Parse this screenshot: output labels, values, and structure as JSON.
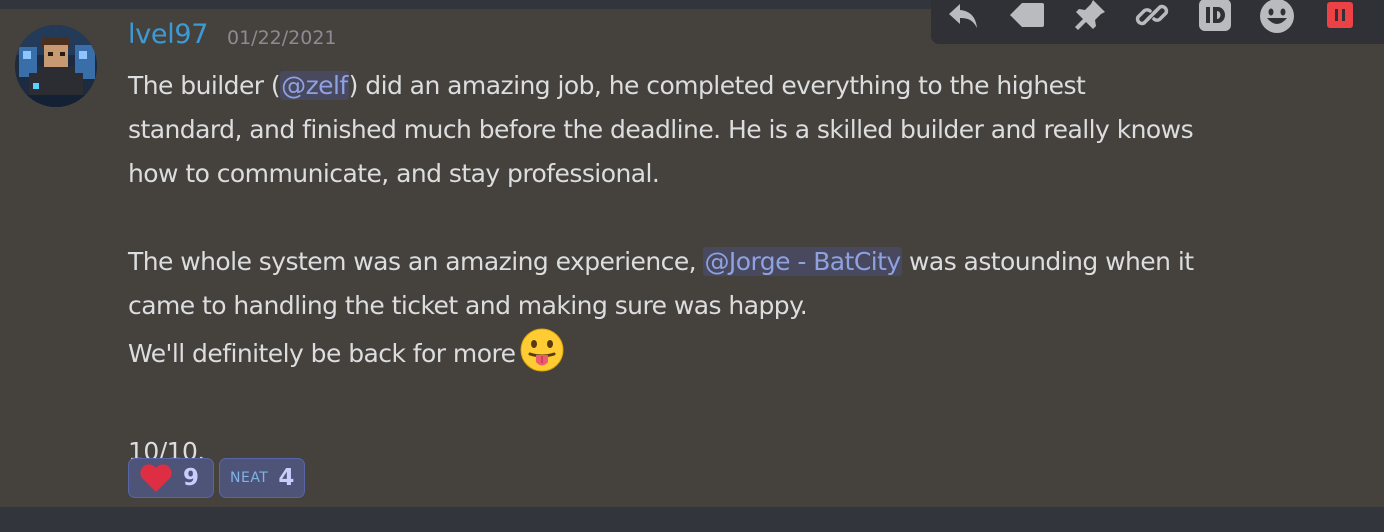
{
  "message": {
    "author": "lvel97",
    "timestamp": "01/22/2021",
    "author_color": "#3c9bd6",
    "paragraphs": {
      "p1_pre": "The builder (",
      "p1_mention": "@zelf",
      "p1_post": ") did an amazing job, he completed everything to the highest",
      "p1_line2": "standard, and finished much before the deadline. He is a skilled builder and really knows",
      "p1_line3": "how to communicate, and stay professional.",
      "p2_pre": "The whole system was an amazing experience, ",
      "p2_mention": "@Jorge - BatCity",
      "p2_post": " was astounding when it",
      "p2_line2": "came to handling the ticket and making sure was happy.",
      "p3": "We'll definitely be back for more",
      "p3_emoji": "stuck-out-tongue-emoji",
      "p4": "10/10."
    }
  },
  "reactions": [
    {
      "emoji": "heart-icon",
      "count": "9"
    },
    {
      "emoji": "neat-custom-emoji",
      "label": "NEAT",
      "count": "4"
    }
  ],
  "toolbar": {
    "icons": [
      "reply-icon",
      "tag-icon",
      "pin-icon",
      "link-icon",
      "id-icon",
      "emoji-icon",
      "delete-icon"
    ]
  },
  "colors": {
    "background": "#45423e",
    "mention": "#8ea1e1",
    "text": "#dcddde",
    "reaction_bg": "#4e5378",
    "delete": "#ed4245"
  }
}
